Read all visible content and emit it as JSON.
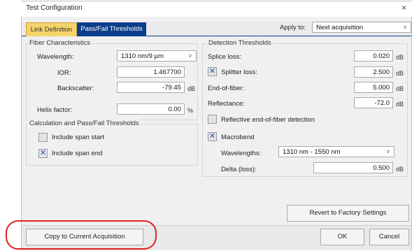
{
  "window": {
    "title": "Test Configuration",
    "close_glyph": "×"
  },
  "tabs": [
    {
      "label": "Link Definition",
      "active": true
    },
    {
      "label": "Pass/Fail Thresholds",
      "active": false
    }
  ],
  "apply_to": {
    "label": "Apply to:",
    "value": "Next acquisition"
  },
  "fiber": {
    "title": "Fiber Characteristics",
    "wavelength_label": "Wavelength:",
    "wavelength_value": "1310 nm/9 µm",
    "ior_label": "IOR:",
    "ior_value": "1.467700",
    "backscatter_label": "Backscatter:",
    "backscatter_value": "-79.45",
    "backscatter_unit": "dB",
    "helix_label": "Helix factor:",
    "helix_value": "0.00",
    "helix_unit": "%"
  },
  "calc": {
    "title": "Calculation and Pass/Fail Thresholds",
    "include_span_start_label": "Include span start",
    "include_span_start_checked": false,
    "include_span_end_label": "Include span end",
    "include_span_end_checked": true
  },
  "detection": {
    "title": "Detection Thresholds",
    "splice_label": "Splice loss:",
    "splice_value": "0.020",
    "splitter_label": "Splitter loss:",
    "splitter_value": "2.500",
    "splitter_checked": true,
    "eof_label": "End-of-fiber:",
    "eof_value": "5.000",
    "reflectance_label": "Reflectance:",
    "reflectance_value": "-72.0",
    "reflective_eof_label": "Reflective end-of-fiber detection",
    "reflective_eof_checked": false,
    "macrobend_label": "Macrobend",
    "macrobend_checked": true,
    "wavelengths_label": "Wavelengths:",
    "wavelengths_value": "1310 nm - 1550 nm",
    "delta_label": "Delta (loss):",
    "delta_value": "0.500",
    "unit": "dB"
  },
  "buttons": {
    "revert": "Revert to Factory Settings",
    "copy": "Copy to Current Acquisition",
    "ok": "OK",
    "cancel": "Cancel"
  },
  "check_glyph": "✕"
}
